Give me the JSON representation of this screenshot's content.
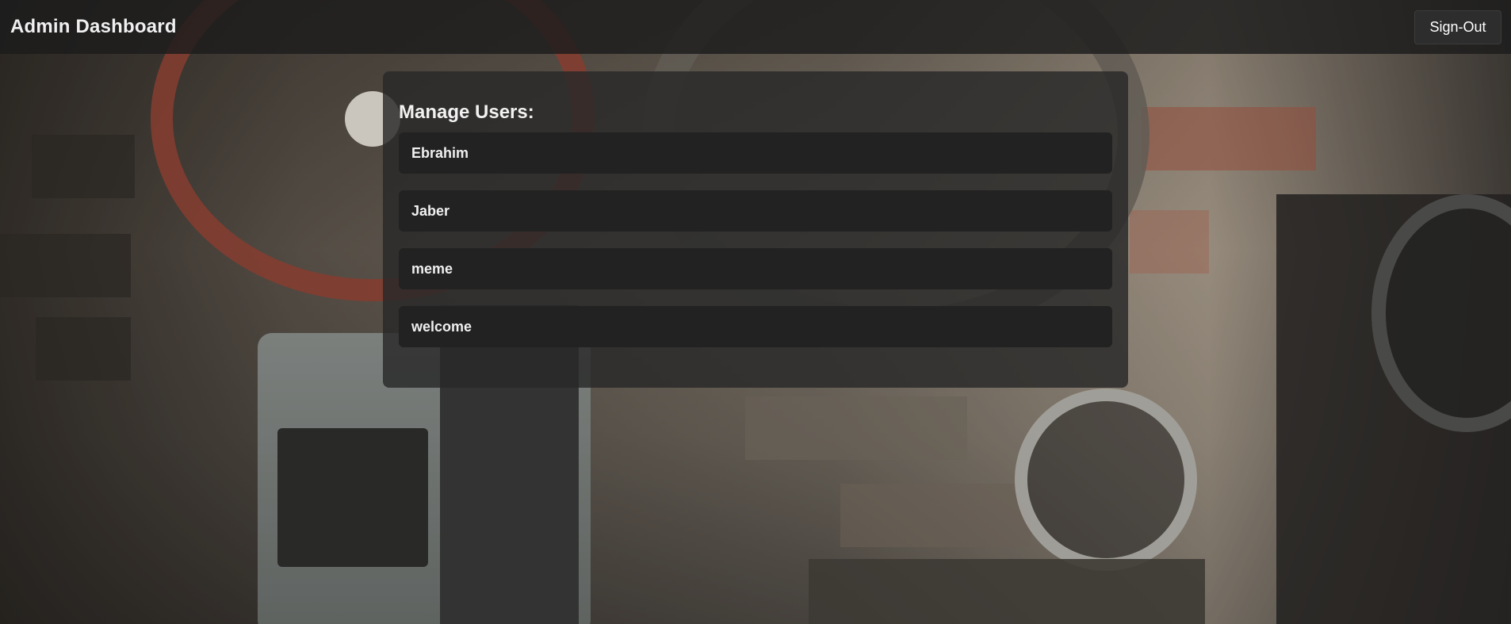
{
  "header": {
    "title": "Admin Dashboard",
    "signout_label": "Sign-Out"
  },
  "panel": {
    "heading": "Manage Users:",
    "users": [
      {
        "name": "Ebrahim"
      },
      {
        "name": "Jaber"
      },
      {
        "name": "meme"
      },
      {
        "name": "welcome"
      }
    ]
  },
  "colors": {
    "navbar_bg": "#1c1c1c",
    "panel_bg": "#282828",
    "item_bg": "#222222",
    "text": "#f0f0f0"
  }
}
